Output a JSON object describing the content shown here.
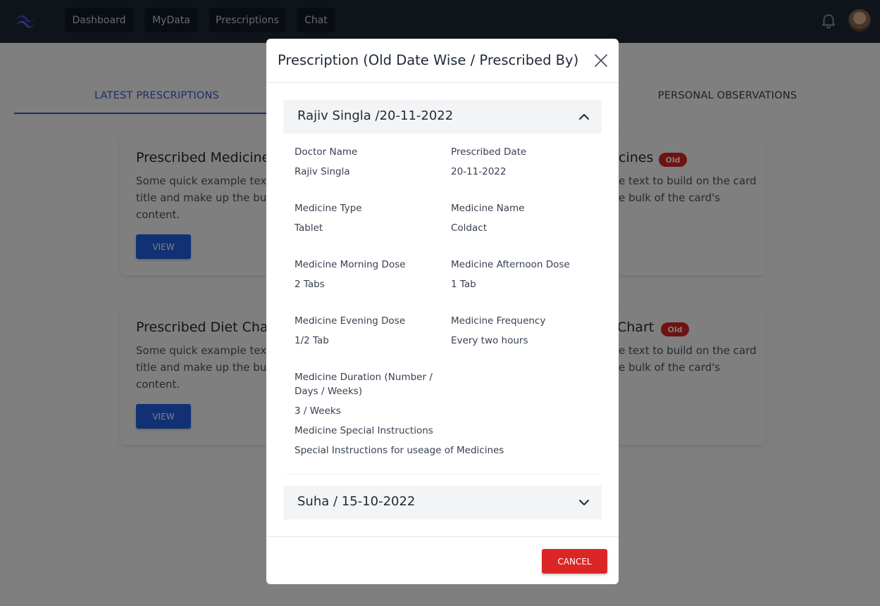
{
  "nav": {
    "items": [
      "Dashboard",
      "MyData",
      "Prescriptions",
      "Chat"
    ]
  },
  "tabs": {
    "latest": "LATEST PRESCRIPTIONS",
    "personal": "PERSONAL OBSERVATIONS"
  },
  "cards": [
    {
      "title": "Prescribed Medicine",
      "text": "Some quick example text to build on the card title and make up the bulk of the card's content.",
      "button": "VIEW"
    },
    {
      "title": "Prescribed Medicines",
      "badge": "Old",
      "text": "Some quick example text to build on the card title and make up the bulk of the card's content."
    },
    {
      "title": "Prescribed Diet Chart",
      "text": "Some quick example text to build on the card title and make up the bulk of the card's content.",
      "button": "VIEW"
    },
    {
      "title": "Prescribed Diet Chart",
      "badge": "Old",
      "text": "Some quick example text to build on the card title and make up the bulk of the card's content."
    }
  ],
  "card_fragments": {
    "c1_title": "Prescribed Medicine",
    "c1_l1": "Some quick example text",
    "c1_l2": "title and make up the bul",
    "c1_l3": "content.",
    "c2_title": "cines",
    "c2_l1": "e text to build on the card",
    "c2_l2": "e bulk of the card's",
    "c3_title": "Prescribed Diet Cha",
    "c3_l1": "Some quick example text",
    "c3_l2": "title and make up the bul",
    "c3_l3": "content.",
    "c4_title": "Chart",
    "c4_l1": "e text to build on the card",
    "c4_l2": "e bulk of the card's",
    "badge": "Old",
    "view": "VIEW"
  },
  "modal": {
    "title": "Prescription (Old Date Wise / Prescribed By)",
    "cancel": "CANCEL",
    "accordion": [
      {
        "header": "Rajiv Singla /20-11-2022",
        "expanded": true,
        "fields": {
          "doctor_name_label": "Doctor Name",
          "doctor_name": "Rajiv Singla",
          "prescribed_date_label": "Prescribed Date",
          "prescribed_date": "20-11-2022",
          "medicine_type_label": "Medicine Type",
          "medicine_type": "Tablet",
          "medicine_name_label": "Medicine Name",
          "medicine_name": "Coldact",
          "morning_dose_label": "Medicine Morning Dose",
          "morning_dose": "2 Tabs",
          "afternoon_dose_label": "Medicine Afternoon Dose",
          "afternoon_dose": "1 Tab",
          "evening_dose_label": "Medicine Evening Dose",
          "evening_dose": "1/2 Tab",
          "frequency_label": "Medicine Frequency",
          "frequency": "Every two hours",
          "duration_label_line1": "Medicine Duration (Number /",
          "duration_label_line2": "Days / Weeks)",
          "duration": "3 / Weeks",
          "special_label": "Medicine Special Instructions",
          "special": "Special Instructions for useage of Medicines"
        }
      },
      {
        "header": "Suha / 15-10-2022",
        "expanded": false
      }
    ]
  },
  "colors": {
    "navbar": "#1f2937",
    "accent": "#3b5bdb",
    "view_button": "#2563eb",
    "danger": "#dc2626"
  },
  "icons": [
    "logo-icon",
    "bell-icon",
    "close-icon",
    "chevron-up-icon",
    "chevron-down-icon"
  ]
}
